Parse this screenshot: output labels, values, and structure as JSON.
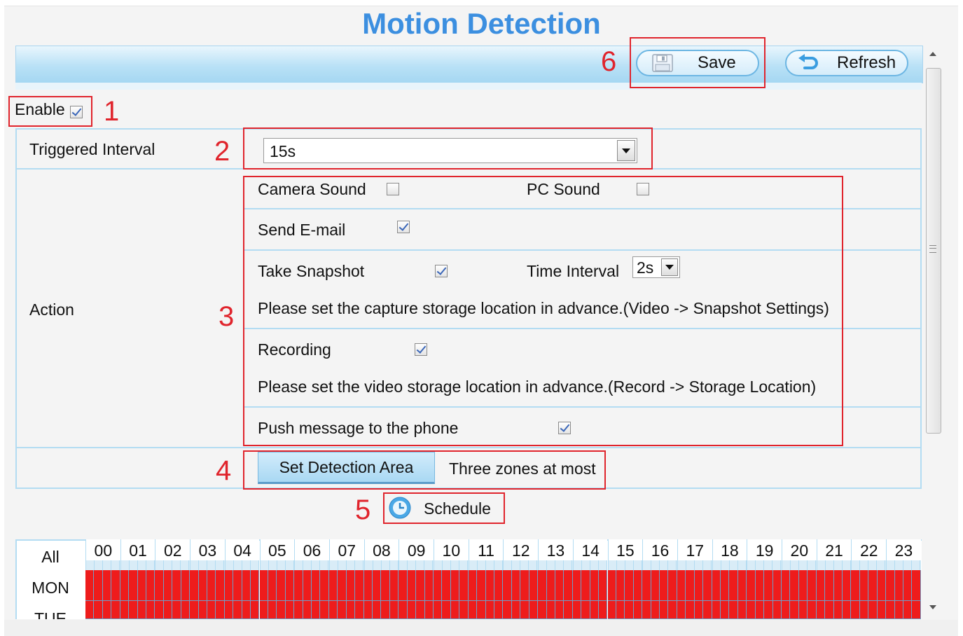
{
  "title": "Motion Detection",
  "toolbar": {
    "save_label": "Save",
    "refresh_label": "Refresh"
  },
  "annotations": [
    "1",
    "2",
    "3",
    "4",
    "5",
    "6"
  ],
  "enable": {
    "label": "Enable",
    "checked": true
  },
  "triggered_interval": {
    "label": "Triggered Interval",
    "value": "15s"
  },
  "action": {
    "label": "Action",
    "camera_sound": {
      "label": "Camera Sound",
      "checked": false
    },
    "pc_sound": {
      "label": "PC Sound",
      "checked": false
    },
    "send_email": {
      "label": "Send E-mail",
      "checked": true
    },
    "take_snapshot": {
      "label": "Take Snapshot",
      "checked": true
    },
    "time_interval": {
      "label": "Time Interval",
      "value": "2s"
    },
    "snapshot_note": "Please set the capture storage location in advance.(Video -> Snapshot Settings)",
    "recording": {
      "label": "Recording",
      "checked": true
    },
    "recording_note": "Please set the video storage location in advance.(Record -> Storage Location)",
    "push_message": {
      "label": "Push message to the phone",
      "checked": true
    }
  },
  "detection_area": {
    "button_label": "Set Detection Area",
    "note": "Three zones at most"
  },
  "schedule": {
    "label": "Schedule",
    "all_label": "All",
    "hours": [
      "00",
      "01",
      "02",
      "03",
      "04",
      "05",
      "06",
      "07",
      "08",
      "09",
      "10",
      "11",
      "12",
      "13",
      "14",
      "15",
      "16",
      "17",
      "18",
      "19",
      "20",
      "21",
      "22",
      "23"
    ],
    "days": [
      "MON",
      "TUE"
    ],
    "cell_color": "#ee1c1c"
  },
  "colors": {
    "title": "#3c8fe0",
    "annotation_red": "#e0242c",
    "border_blue": "#b3dcf2"
  }
}
